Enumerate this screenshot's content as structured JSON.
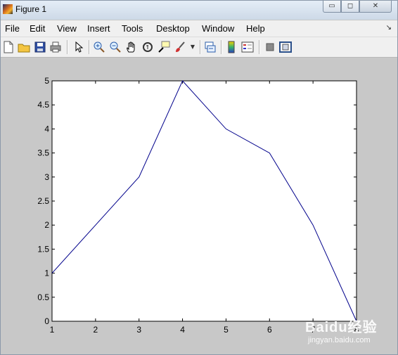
{
  "window": {
    "title": "Figure 1",
    "min_glyph": "▭",
    "max_glyph": "◻",
    "close_glyph": "✕"
  },
  "menubar": {
    "items": [
      "File",
      "Edit",
      "View",
      "Insert",
      "Tools",
      "Desktop",
      "Window",
      "Help"
    ],
    "dock_arrow": "↘"
  },
  "toolbar": {
    "icons": [
      "new-figure-icon",
      "open-file-icon",
      "save-icon",
      "print-icon",
      "arrow-pointer-icon",
      "zoom-in-icon",
      "zoom-out-icon",
      "pan-hand-icon",
      "rotate-3d-icon",
      "data-cursor-icon",
      "brush-icon",
      "link-plot-icon",
      "colorbar-icon",
      "legend-icon",
      "hide-plot-tools-icon",
      "show-plot-tools-icon"
    ]
  },
  "watermark": {
    "logo": "Baidu经验",
    "url": "jingyan.baidu.com"
  },
  "chart_data": {
    "type": "line",
    "x": [
      1,
      2,
      3,
      4,
      5,
      6,
      7,
      8
    ],
    "series": [
      {
        "values": [
          1,
          2,
          3,
          5,
          4,
          3.5,
          2,
          0
        ],
        "color": "#00008b"
      }
    ],
    "xlim": [
      1,
      8
    ],
    "ylim": [
      0,
      5
    ],
    "xticks": [
      "1",
      "2",
      "3",
      "4",
      "5",
      "6",
      "7",
      "8"
    ],
    "yticks": [
      "0",
      "0.5",
      "1",
      "1.5",
      "2",
      "2.5",
      "3",
      "3.5",
      "4",
      "4.5",
      "5"
    ],
    "title": "",
    "xlabel": "",
    "ylabel": "",
    "grid": false
  }
}
